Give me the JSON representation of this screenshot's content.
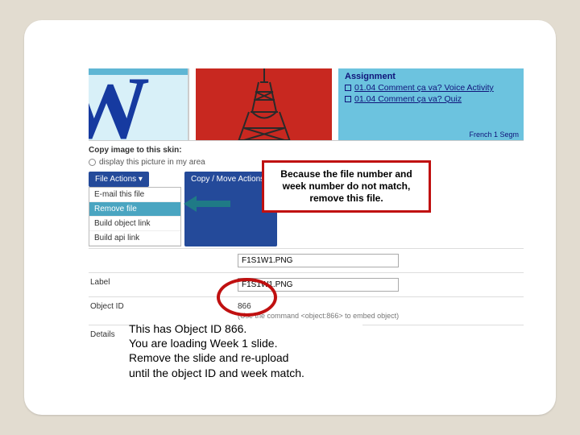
{
  "banner": {
    "assignment_title": "Assignment",
    "items": [
      "01.04 Comment ça va? Voice Activity",
      "01.04 Comment ça va? Quiz"
    ],
    "footer": "French 1 Segm"
  },
  "section": {
    "copy_label": "Copy image to this skin:",
    "display_label": "display this picture in my area"
  },
  "buttons": {
    "file_actions": "File Actions ▾",
    "copy_move": "Copy / Move Actions ▾"
  },
  "dropdown": {
    "items": [
      "E-mail this file",
      "Remove file",
      "Build object link",
      "Build api link"
    ]
  },
  "form": {
    "filename_label": "",
    "filename_value": "F1S1W1.PNG",
    "label_label": "Label",
    "label_value": "F1S1W1.PNG",
    "objectid_label": "Object ID",
    "objectid_value": "866",
    "objectid_hint": "(Use the command <object:866> to embed object)",
    "details_label": "Details"
  },
  "callout": "Because the file number and week number do not match, remove this file.",
  "caption": {
    "l1": "This has Object ID 866.",
    "l2": "You are loading Week 1 slide.",
    "l3": "Remove the slide and re-upload",
    "l4": "until the object ID and week match."
  }
}
